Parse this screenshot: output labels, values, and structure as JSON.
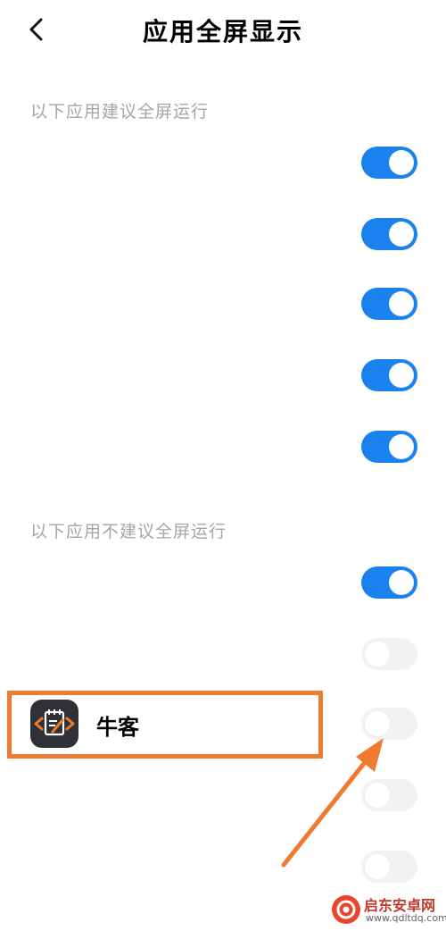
{
  "header": {
    "title": "应用全屏显示",
    "back_icon": "chevron-left-icon"
  },
  "sections": {
    "recommended_label": "以下应用建议全屏运行",
    "not_recommended_label": "以下应用不建议全屏运行"
  },
  "recommended_apps": [
    {
      "enabled": true
    },
    {
      "enabled": true
    },
    {
      "enabled": true
    },
    {
      "enabled": true
    },
    {
      "enabled": true
    }
  ],
  "not_recommended_apps": [
    {
      "enabled": true
    },
    {
      "enabled": false
    },
    {
      "name": "牛客",
      "enabled": false,
      "icon": "notebook-code-icon"
    },
    {
      "enabled": false
    },
    {
      "enabled": false
    }
  ],
  "annotation": {
    "highlight_color": "#f07a30",
    "arrow_color": "#f07a30"
  },
  "colors": {
    "toggle_on": "#1a82ee",
    "toggle_off": "#f2f2f2",
    "section_label": "#a6a6a6"
  },
  "watermark": {
    "title": "启东安卓网",
    "url": "www.qdltdq.com"
  }
}
